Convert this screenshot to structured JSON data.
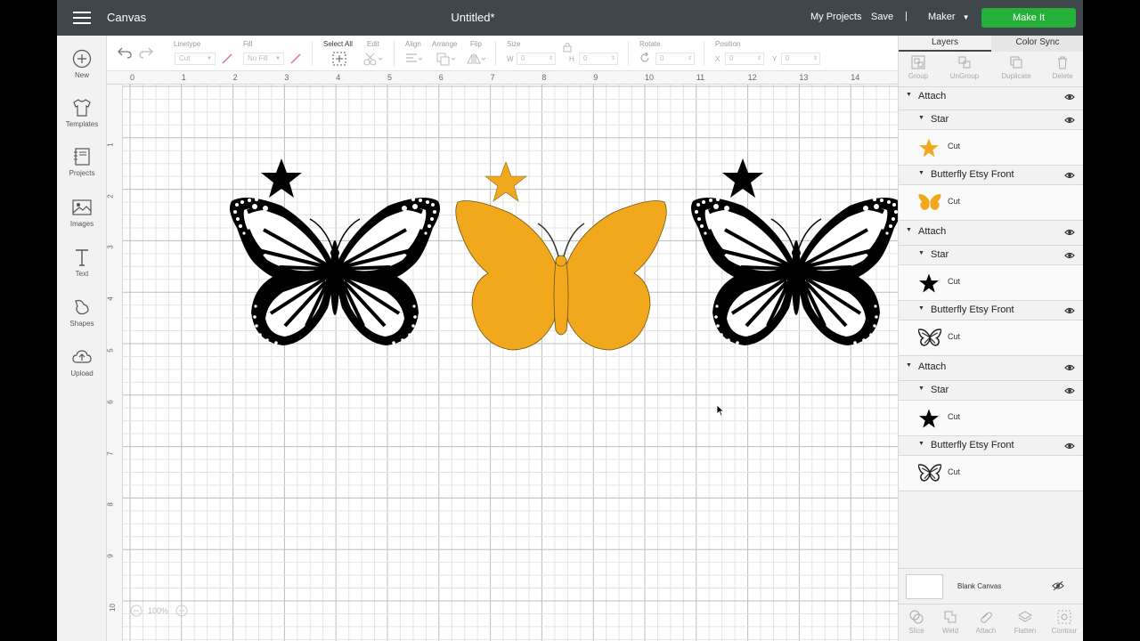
{
  "topbar": {
    "app_title": "Canvas",
    "doc_title": "Untitled*",
    "my_projects": "My Projects",
    "save": "Save",
    "separator": "|",
    "machine": "Maker",
    "make_it": "Make It"
  },
  "left_nav": [
    {
      "label": "New",
      "icon": "plus-circle-icon"
    },
    {
      "label": "Templates",
      "icon": "tshirt-icon"
    },
    {
      "label": "Projects",
      "icon": "notebook-icon"
    },
    {
      "label": "Images",
      "icon": "picture-icon"
    },
    {
      "label": "Text",
      "icon": "text-icon"
    },
    {
      "label": "Shapes",
      "icon": "shapes-icon"
    },
    {
      "label": "Upload",
      "icon": "cloud-upload-icon"
    }
  ],
  "toolbar": {
    "linetype_label": "Linetype",
    "linetype_value": "Cut",
    "fill_label": "Fill",
    "fill_value": "No Fill",
    "select_all": "Select All",
    "edit": "Edit",
    "align": "Align",
    "arrange": "Arrange",
    "flip": "Flip",
    "size": "Size",
    "w_label": "W",
    "w_value": "0",
    "h_label": "H",
    "h_value": "0",
    "rotate": "Rotate",
    "rotate_value": "0",
    "position": "Position",
    "x_label": "X",
    "x_value": "0",
    "y_label": "Y",
    "y_value": "0"
  },
  "ruler": {
    "top": [
      "0",
      "1",
      "2",
      "3",
      "4",
      "5",
      "6",
      "7",
      "8",
      "9",
      "10",
      "11",
      "12",
      "13",
      "14"
    ],
    "left": [
      "1",
      "2",
      "3",
      "4",
      "5",
      "6",
      "7",
      "8",
      "9",
      "10"
    ]
  },
  "zoom": "100%",
  "colors": {
    "accent_green": "#25b03a",
    "topbar": "#3f474d",
    "butterfly_yellow": "#f2a81d",
    "black": "#000000"
  },
  "panel": {
    "tab_layers": "Layers",
    "tab_color_sync": "Color Sync",
    "actions": [
      "Group",
      "UnGroup",
      "Duplicate",
      "Delete"
    ],
    "groups": [
      {
        "label": "Attach",
        "items": [
          {
            "name": "Star",
            "op": "Cut",
            "thumb": "yellow-star"
          },
          {
            "name": "Butterfly Etsy Front",
            "op": "Cut",
            "thumb": "yellow-butterfly"
          }
        ]
      },
      {
        "label": "Attach",
        "items": [
          {
            "name": "Star",
            "op": "Cut",
            "thumb": "black-star"
          },
          {
            "name": "Butterfly Etsy Front",
            "op": "Cut",
            "thumb": "black-butterfly"
          }
        ]
      },
      {
        "label": "Attach",
        "items": [
          {
            "name": "Star",
            "op": "Cut",
            "thumb": "black-star"
          },
          {
            "name": "Butterfly Etsy Front",
            "op": "Cut",
            "thumb": "black-butterfly"
          }
        ]
      }
    ],
    "blank_canvas": "Blank Canvas",
    "bottom_actions": [
      "Slice",
      "Weld",
      "Attach",
      "Flatten",
      "Contour"
    ]
  }
}
